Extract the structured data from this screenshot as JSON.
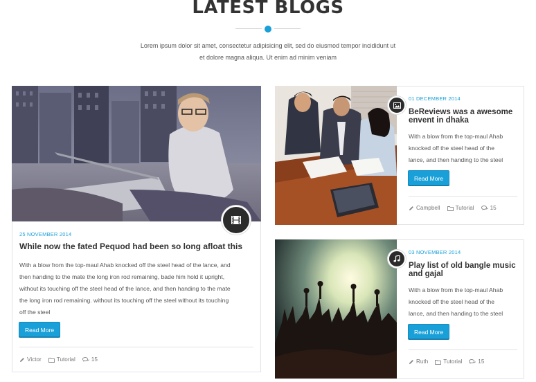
{
  "section": {
    "title": "LATEST BLOGS",
    "description_line1": "Lorem ipsum dolor sit amet, consectetur adipisicing elit, sed do eiusmod tempor incididunt ut",
    "description_line2": "et dolore magna aliqua. Ut enim ad minim veniam",
    "accent_color": "#1aa0d8"
  },
  "posts": [
    {
      "type_icon": "film-icon",
      "date": "25 NOVEMBER 2014",
      "title": "While now the fated Pequod had been so long afloat this",
      "excerpt_lines": [
        "With a blow from the top-maul Ahab knocked off the steel head of the lance, and",
        "then handing to the mate the long iron rod remaining, bade him hold it upright,",
        "without its touching off the steel head of the lance, and then handing to the mate",
        "the long iron rod remaining. without its touching off the steel without its touching",
        "off the steel"
      ],
      "read_more": "Read More",
      "author": "Victor",
      "category": "Tutorial",
      "comments": "15"
    },
    {
      "type_icon": "image-icon",
      "date": "01 DECEMBER 2014",
      "title_line1": "BeReviews was a awesome",
      "title_line2": "envent in dhaka",
      "excerpt_lines": [
        "With a blow from the top-maul Ahab",
        "knocked off the steel head of the",
        "lance, and then handing to the steel"
      ],
      "read_more": "Read More",
      "author": "Campbell",
      "category": "Tutorial",
      "comments": "15"
    },
    {
      "type_icon": "music-note-icon",
      "date": "03 NOVEMBER 2014",
      "title_line1": "Play list of old bangle music",
      "title_line2": "and gajal",
      "excerpt_lines": [
        "With a blow from the top-maul Ahab",
        "knocked off the steel head of the",
        "lance, and then handing to the steel"
      ],
      "read_more": "Read More",
      "author": "Ruth",
      "category": "Tutorial",
      "comments": "15"
    }
  ]
}
